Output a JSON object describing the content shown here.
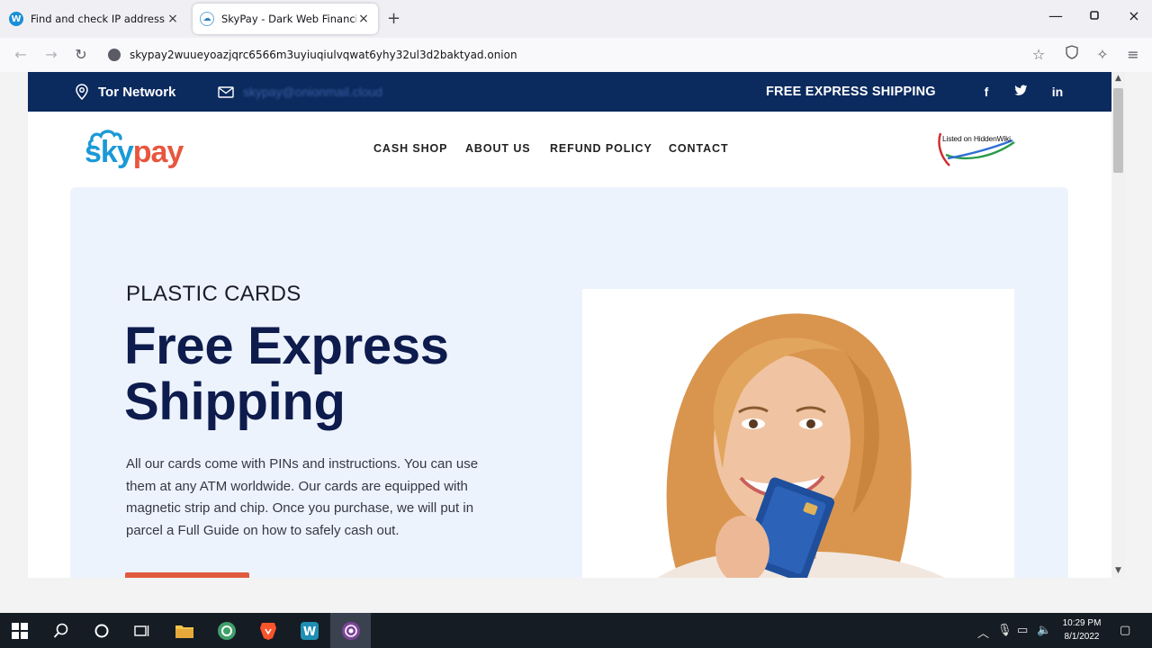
{
  "browser": {
    "tabs": [
      {
        "label": "Find and check IP address",
        "active": false
      },
      {
        "label": "SkyPay - Dark Web Financial Ve",
        "active": true
      }
    ],
    "url": "skypay2wuueyoazjqrc6566m3uyiuqiulvqwat6yhy32ul3d2baktyad.onion",
    "new_tab": "+",
    "close_glyph": "×"
  },
  "site": {
    "topbar": {
      "location": "Tor Network",
      "email": "skypay@onionmail.cloud",
      "shipping": "FREE EXPRESS SHIPPING",
      "social": [
        "facebook-icon",
        "twitter-icon",
        "linkedin-icon"
      ]
    },
    "logo": {
      "part1": "sky",
      "part2": "pay",
      "color1": "#1b9ad6",
      "color2": "#e8563e"
    },
    "menu": [
      "CASH SHOP",
      "ABOUT US",
      "REFUND POLICY",
      "CONTACT"
    ],
    "badge": "Listed on HiddenWiki",
    "hero": {
      "kicker": "PLASTIC CARDS",
      "headline_line1": "Free Express",
      "headline_line2": "Shipping",
      "description": "All our cards come with PINs and instructions. You can use them at any ATM worldwide. Our cards are equipped with magnetic strip and chip. Once you purchase, we will put in parcel a Full Guide on how to safely cash out."
    },
    "colors": {
      "navy": "#0b2a5e",
      "accent": "#e05a3f",
      "hero_bg": "#edf3fc"
    }
  },
  "taskbar": {
    "time": "10:29 PM",
    "date": "8/1/2022"
  }
}
